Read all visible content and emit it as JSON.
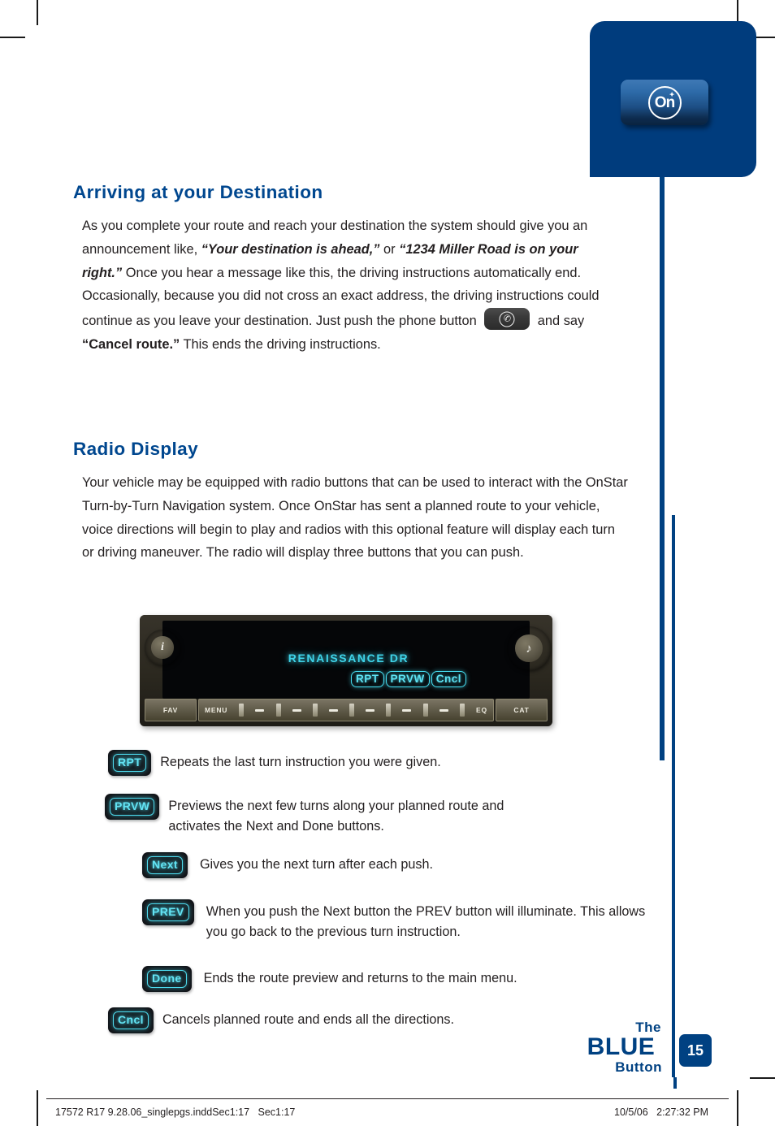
{
  "page": {
    "number": "15",
    "brand_logo": {
      "line1": "The",
      "line2": "BLUE",
      "line3": "Button"
    },
    "accent_blue": "#004182",
    "heading_blue": "#00478f",
    "display_cyan": "#4fdcef"
  },
  "onstar": {
    "logo_text": "On",
    "star_glyph": "✦"
  },
  "sections": [
    {
      "heading": "Arriving at your Destination",
      "paragraph_parts": [
        {
          "type": "text",
          "value": "As you complete your route and reach your destination the system should give you an announcement like, "
        },
        {
          "type": "italic",
          "value": "“Your destination is ahead,”"
        },
        {
          "type": "text",
          "value": " or "
        },
        {
          "type": "italic",
          "value": "“1234 Miller Road is on your right.”"
        },
        {
          "type": "text",
          "value": " Once you hear a message like this, the driving instructions automatically end. Occasionally, because you did not cross an exact address, the driving instructions could continue as you leave your destination. Just push the phone button "
        },
        {
          "type": "icon",
          "value": "phone-button"
        },
        {
          "type": "text",
          "value": " and say "
        },
        {
          "type": "quote",
          "value": "“Cancel route.”"
        },
        {
          "type": "text",
          "value": " This ends the driving instructions."
        }
      ]
    },
    {
      "heading": "Radio Display",
      "paragraph": "Your vehicle may be equipped with radio buttons that can be used to interact with the OnStar Turn-by-Turn Navigation system. Once OnStar has sent a planned route to your vehicle, voice directions will begin to play and radios with this optional feature will display each turn or driving maneuver. The radio will display three buttons that you can push."
    }
  ],
  "radio_photo": {
    "street_name": "RENAISSANCE DR",
    "softkeys": [
      "RPT",
      "PRVW",
      "Cncl"
    ],
    "left_knob_glyph": "i",
    "right_knob_glyph": "♪",
    "lower_buttons": {
      "fav": "FAV",
      "menu": "MENU",
      "eq": "EQ",
      "cat": "CAT"
    }
  },
  "button_list": [
    {
      "label": "RPT",
      "description": "Repeats the last turn instruction you were given."
    },
    {
      "label": "PRVW",
      "description": "Previews the next few turns along your planned route and activates the Next and Done buttons."
    },
    {
      "label": "Next",
      "description": "Gives you the next turn after each push."
    },
    {
      "label": "PREV",
      "description": "When you push the Next button the PREV button will illuminate. This allows you go back to the previous turn instruction."
    },
    {
      "label": "Done",
      "description": "Ends the route preview and returns to the main menu."
    },
    {
      "label": "Cncl",
      "description": "Cancels planned route and ends all the directions."
    }
  ],
  "footer": {
    "left": "17572 R17 9.28.06_singlepgs.inddSec1:17   Sec1:17",
    "right": "10/5/06   2:27:32 PM"
  }
}
